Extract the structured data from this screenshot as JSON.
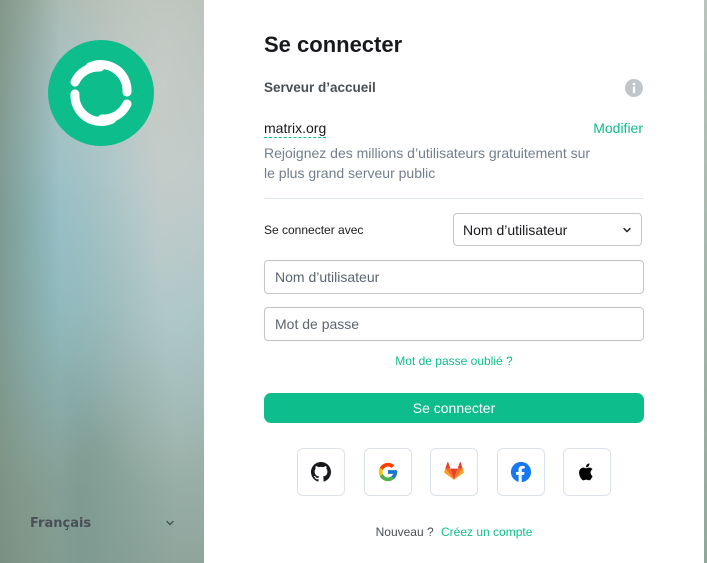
{
  "sidebar": {
    "language": "Français",
    "colors": {
      "logo": "#0dbd8b"
    }
  },
  "login": {
    "title": "Se connecter",
    "homeserver_label": "Serveur d’accueil",
    "server_name": "matrix.org",
    "modify_label": "Modifier",
    "server_description": "Rejoignez des millions d’utilisateurs gratuitement sur le plus grand serveur public",
    "login_with_label": "Se connecter avec",
    "login_with_value": "Nom d’utilisateur",
    "username_placeholder": "Nom d’utilisateur",
    "password_placeholder": "Mot de passe",
    "forgot_password": "Mot de passe oublié ?",
    "submit_label": "Se connecter",
    "sso_providers": [
      "github-icon",
      "google-icon",
      "gitlab-icon",
      "facebook-icon",
      "apple-icon"
    ],
    "new_user_label": "Nouveau ?",
    "create_account": "Créez un compte",
    "accent_color": "#0dbd8b"
  }
}
